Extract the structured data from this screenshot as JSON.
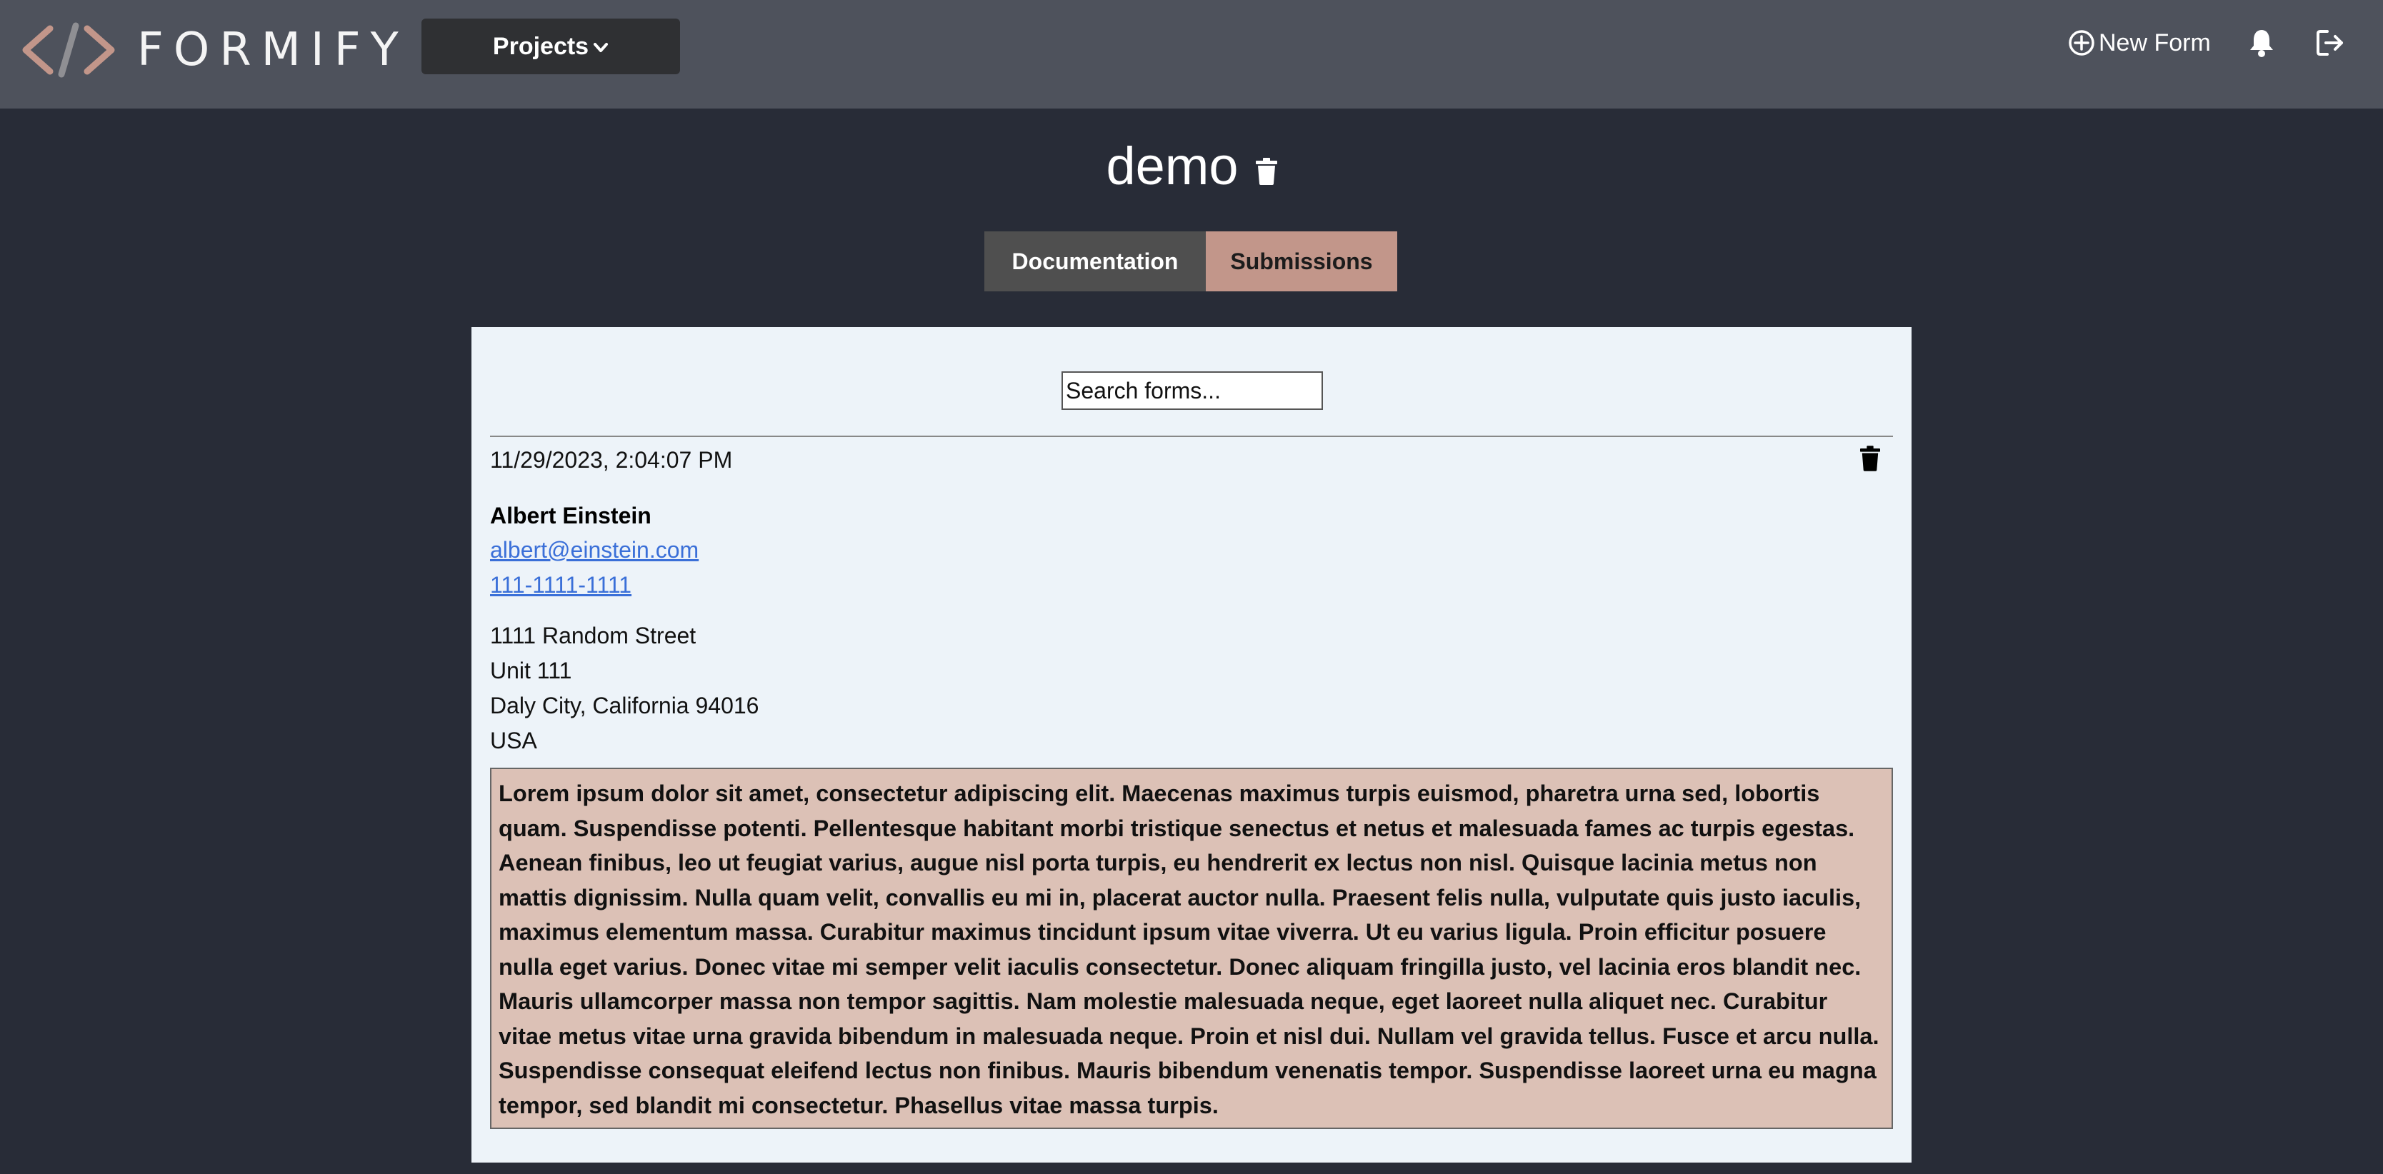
{
  "app": {
    "brand": "FORMIFY",
    "colors": {
      "topbar": "#4e525c",
      "background": "#282c37",
      "accent": "#c2968a",
      "panel": "#edf3f9",
      "message": "#dcc1b6"
    }
  },
  "header": {
    "projects_label": "Projects",
    "new_form_label": "New Form",
    "icons": [
      "code-logo-icon",
      "chevron-down-icon",
      "plus-circle-icon",
      "bell-icon",
      "logout-icon"
    ]
  },
  "page": {
    "title": "demo"
  },
  "tabs": [
    {
      "label": "Documentation",
      "active": false
    },
    {
      "label": "Submissions",
      "active": true
    }
  ],
  "search": {
    "placeholder": "Search forms..."
  },
  "submission": {
    "timestamp": "11/29/2023, 2:04:07 PM",
    "name": "Albert Einstein",
    "email": "albert@einstein.com",
    "phone": "111-1111-1111",
    "address": {
      "line1": "1111 Random Street",
      "line2": "Unit 111",
      "city_line": "Daly City, California 94016",
      "country": "USA"
    },
    "message": "Lorem ipsum dolor sit amet, consectetur adipiscing elit. Maecenas maximus turpis euismod, pharetra urna sed, lobortis quam. Suspendisse potenti. Pellentesque habitant morbi tristique senectus et netus et malesuada fames ac turpis egestas. Aenean finibus, leo ut feugiat varius, augue nisl porta turpis, eu hendrerit ex lectus non nisl. Quisque lacinia metus non mattis dignissim. Nulla quam velit, convallis eu mi in, placerat auctor nulla. Praesent felis nulla, vulputate quis justo iaculis, maximus elementum massa. Curabitur maximus tincidunt ipsum vitae viverra. Ut eu varius ligula. Proin efficitur posuere nulla eget varius. Donec vitae mi semper velit iaculis consectetur. Donec aliquam fringilla justo, vel lacinia eros blandit nec. Mauris ullamcorper massa non tempor sagittis. Nam molestie malesuada neque, eget laoreet nulla aliquet nec. Curabitur vitae metus vitae urna gravida bibendum in malesuada neque. Proin et nisl dui. Nullam vel gravida tellus. Fusce et arcu nulla. Suspendisse consequat eleifend lectus non finibus. Mauris bibendum venenatis tempor. Suspendisse laoreet urna eu magna tempor, sed blandit mi consectetur. Phasellus vitae massa turpis."
  }
}
